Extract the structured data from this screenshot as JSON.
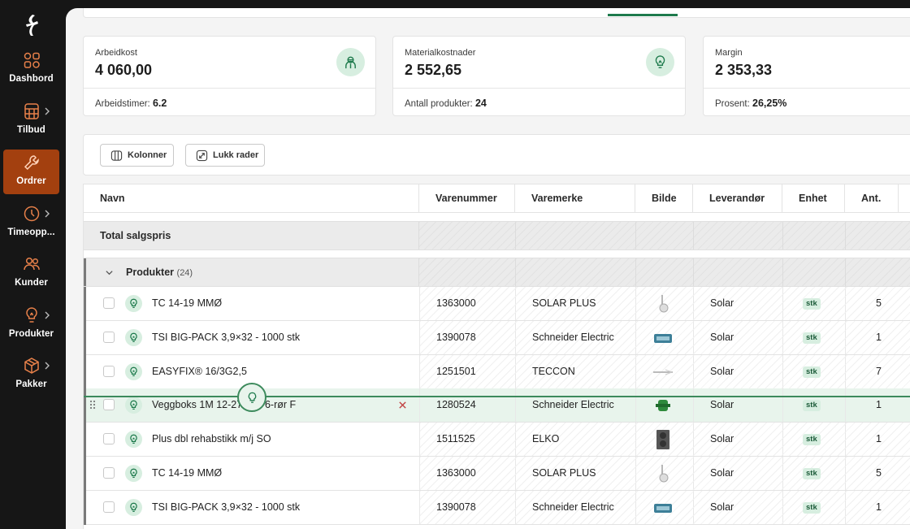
{
  "sidebar": {
    "items": [
      {
        "label": "Dashbord",
        "icon": "dashboard-grid-icon",
        "active": false,
        "has_submenu": false
      },
      {
        "label": "Tilbud",
        "icon": "calculator-icon",
        "active": false,
        "has_submenu": true
      },
      {
        "label": "Ordrer",
        "icon": "wrench-icon",
        "active": true,
        "has_submenu": false
      },
      {
        "label": "Timeopp...",
        "icon": "clock-icon",
        "active": false,
        "has_submenu": true
      },
      {
        "label": "Kunder",
        "icon": "users-icon",
        "active": false,
        "has_submenu": false
      },
      {
        "label": "Produkter",
        "icon": "lightbulb-icon",
        "active": false,
        "has_submenu": true
      },
      {
        "label": "Pakker",
        "icon": "package-icon",
        "active": false,
        "has_submenu": true
      }
    ]
  },
  "cards": [
    {
      "title": "Arbeidkost",
      "value": "4 060,00",
      "footer_label": "Arbeidstimer:",
      "footer_value": "6.2",
      "icon": "worker-icon"
    },
    {
      "title": "Materialkostnader",
      "value": "2 552,65",
      "footer_label": "Antall produkter:",
      "footer_value": "24",
      "icon": "lightbulb-icon"
    },
    {
      "title": "Margin",
      "value": "2 353,33",
      "footer_label": "Prosent:",
      "footer_value": "26,25%"
    }
  ],
  "toolbar": {
    "columns_label": "Kolonner",
    "collapse_label": "Lukk rader"
  },
  "table": {
    "headers": [
      "Navn",
      "Varenummer",
      "Varemerke",
      "Bilde",
      "Leverandør",
      "Enhet",
      "Ant."
    ],
    "total_label": "Total salgspris",
    "group": {
      "label": "Produkter",
      "count": "(24)"
    },
    "rows": [
      {
        "name": "TC 14-19 MMØ",
        "number": "1363000",
        "brand": "SOLAR PLUS",
        "image": "clip-icon",
        "supplier": "Solar",
        "unit": "stk",
        "qty": "5",
        "selected": false
      },
      {
        "name": "TSI BIG-PACK 3,9×32 - 1000 stk",
        "number": "1390078",
        "brand": "Schneider Electric",
        "image": "box-icon",
        "supplier": "Solar",
        "unit": "stk",
        "qty": "1",
        "selected": false
      },
      {
        "name": "EASYFIX® 16/3G2,5",
        "number": "1251501",
        "brand": "TECCON",
        "image": "cable-icon",
        "supplier": "Solar",
        "unit": "stk",
        "qty": "7",
        "selected": false
      },
      {
        "name": "Veggboks 1M 12-27 mm 6-rør F",
        "number": "1280524",
        "brand": "Schneider Electric",
        "image": "wallbox-icon",
        "supplier": "Solar",
        "unit": "stk",
        "qty": "1",
        "selected": true
      },
      {
        "name": "Plus dbl rehabstikk m/j SO",
        "number": "1511525",
        "brand": "ELKO",
        "image": "socket-icon",
        "supplier": "Solar",
        "unit": "stk",
        "qty": "1",
        "selected": false
      },
      {
        "name": "TC 14-19 MMØ",
        "number": "1363000",
        "brand": "SOLAR PLUS",
        "image": "clip-icon",
        "supplier": "Solar",
        "unit": "stk",
        "qty": "5",
        "selected": false
      },
      {
        "name": "TSI BIG-PACK 3,9×32 - 1000 stk",
        "number": "1390078",
        "brand": "Schneider Electric",
        "image": "box-icon",
        "supplier": "Solar",
        "unit": "stk",
        "qty": "1",
        "selected": false
      }
    ]
  },
  "colors": {
    "accent": "#a3400f",
    "green": "#1e7a4c",
    "badge_bg": "#d7eee0"
  }
}
